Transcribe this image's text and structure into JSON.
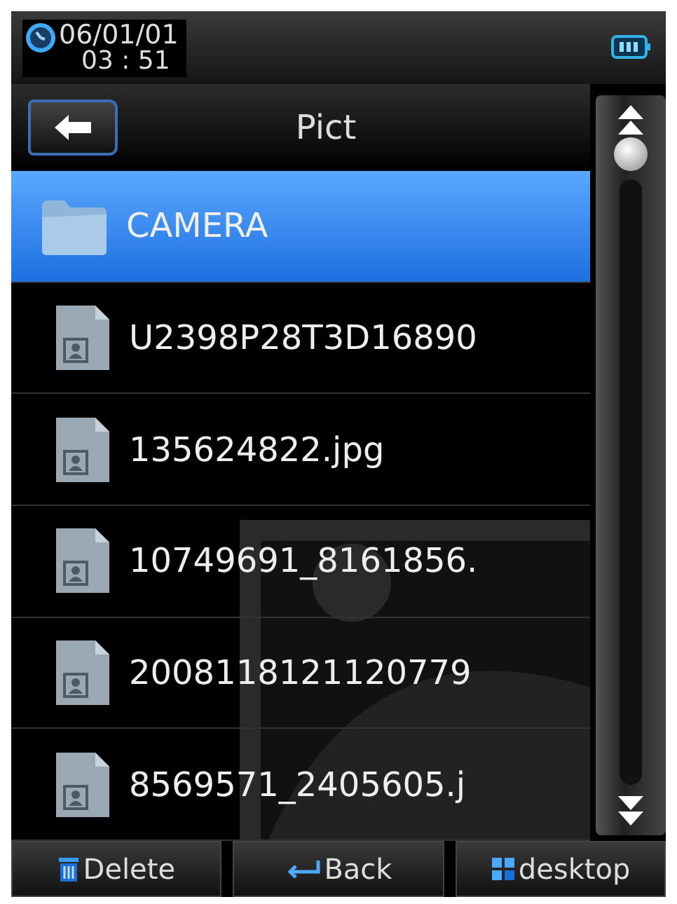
{
  "status_bar": {
    "date": "06/01/01",
    "time": "03 : 51"
  },
  "header": {
    "title": "Pict"
  },
  "files": [
    {
      "kind": "folder",
      "name": "CAMERA",
      "selected": true
    },
    {
      "kind": "image",
      "name": "U2398P28T3D16890",
      "selected": false
    },
    {
      "kind": "image",
      "name": "135624822.jpg",
      "selected": false
    },
    {
      "kind": "image",
      "name": "10749691_8161856.",
      "selected": false
    },
    {
      "kind": "image",
      "name": "2008118121120779",
      "selected": false
    },
    {
      "kind": "image",
      "name": "8569571_2405605.j",
      "selected": false
    }
  ],
  "buttons": [
    {
      "kind": "delete",
      "label": "Delete"
    },
    {
      "kind": "back",
      "label": "Back"
    },
    {
      "kind": "desktop",
      "label": "desktop"
    }
  ]
}
